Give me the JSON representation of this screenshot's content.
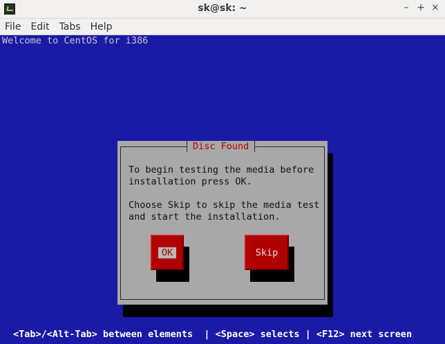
{
  "window": {
    "title": "sk@sk: ~",
    "controls": {
      "minimize": "–",
      "maximize": "+",
      "close": "×"
    }
  },
  "menubar": {
    "items": [
      {
        "label": "File"
      },
      {
        "label": "Edit"
      },
      {
        "label": "Tabs"
      },
      {
        "label": "Help"
      }
    ]
  },
  "terminal": {
    "welcome": "Welcome to CentOS for i386",
    "dialog": {
      "title": "Disc Found",
      "paragraph1_line1": "To begin testing the media before",
      "paragraph1_line2": "installation press OK.",
      "paragraph2_line1": "Choose Skip to skip the media test",
      "paragraph2_line2": "and start the installation.",
      "ok_label": "OK",
      "skip_label": "Skip"
    },
    "helpline": "<Tab>/<Alt-Tab> between elements  | <Space> selects | <F12> next screen"
  },
  "colors": {
    "terminal_bg": "#1a1aa6",
    "dialog_bg": "#a8a8a8",
    "button_bg": "#b00000",
    "title_text": "#b30000"
  }
}
